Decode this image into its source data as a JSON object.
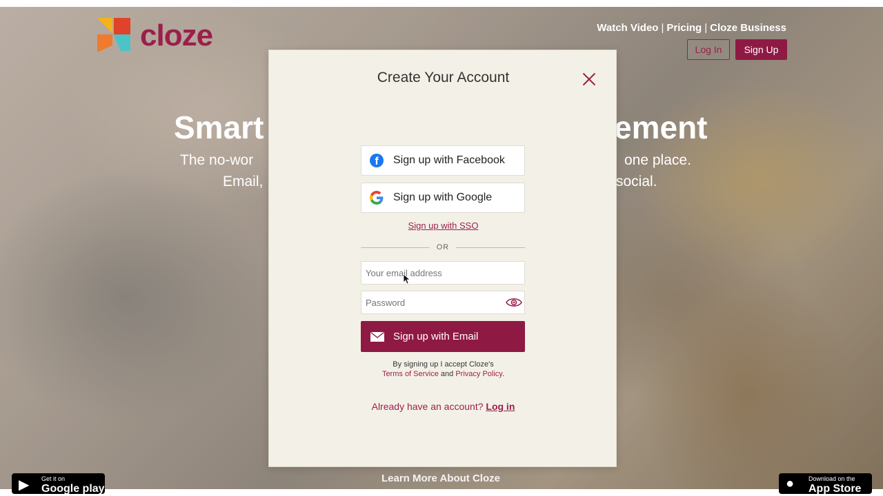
{
  "background": {
    "logo_text": "cloze",
    "nav_links": [
      "Watch Video",
      "Pricing",
      "Cloze Business"
    ],
    "nav_separator": "|",
    "login_label": "Log In",
    "signup_label": "Sign Up",
    "hero_left": "Smart",
    "hero_right": "ement",
    "sub_left_1": "The no-wor",
    "sub_left_2": "Email,",
    "sub_right_1": "one place.",
    "sub_right_2": "social.",
    "learn_more": "Learn More About Cloze",
    "google_play_small": "Get it on",
    "google_play_big": "Google play",
    "app_store_small": "Download on the",
    "app_store_big": "App Store"
  },
  "modal": {
    "title": "Create Your Account",
    "facebook_label": "Sign up with Facebook",
    "google_label": "Sign up with Google",
    "sso_label": "Sign up with SSO",
    "or_label": "OR",
    "email_placeholder": "Your email address",
    "password_placeholder": "Password",
    "email_button_label": "Sign up with Email",
    "legal_prefix": "By signing up I accept Cloze's",
    "terms_label": "Terms of Service",
    "and_label": "and",
    "privacy_label": "Privacy Policy",
    "period": ".",
    "already_label": "Already have an account?",
    "login_link": "Log in"
  },
  "colors": {
    "brand": "#8e1a44",
    "modal_bg": "#f3f1e7",
    "facebook": "#1877f2"
  }
}
